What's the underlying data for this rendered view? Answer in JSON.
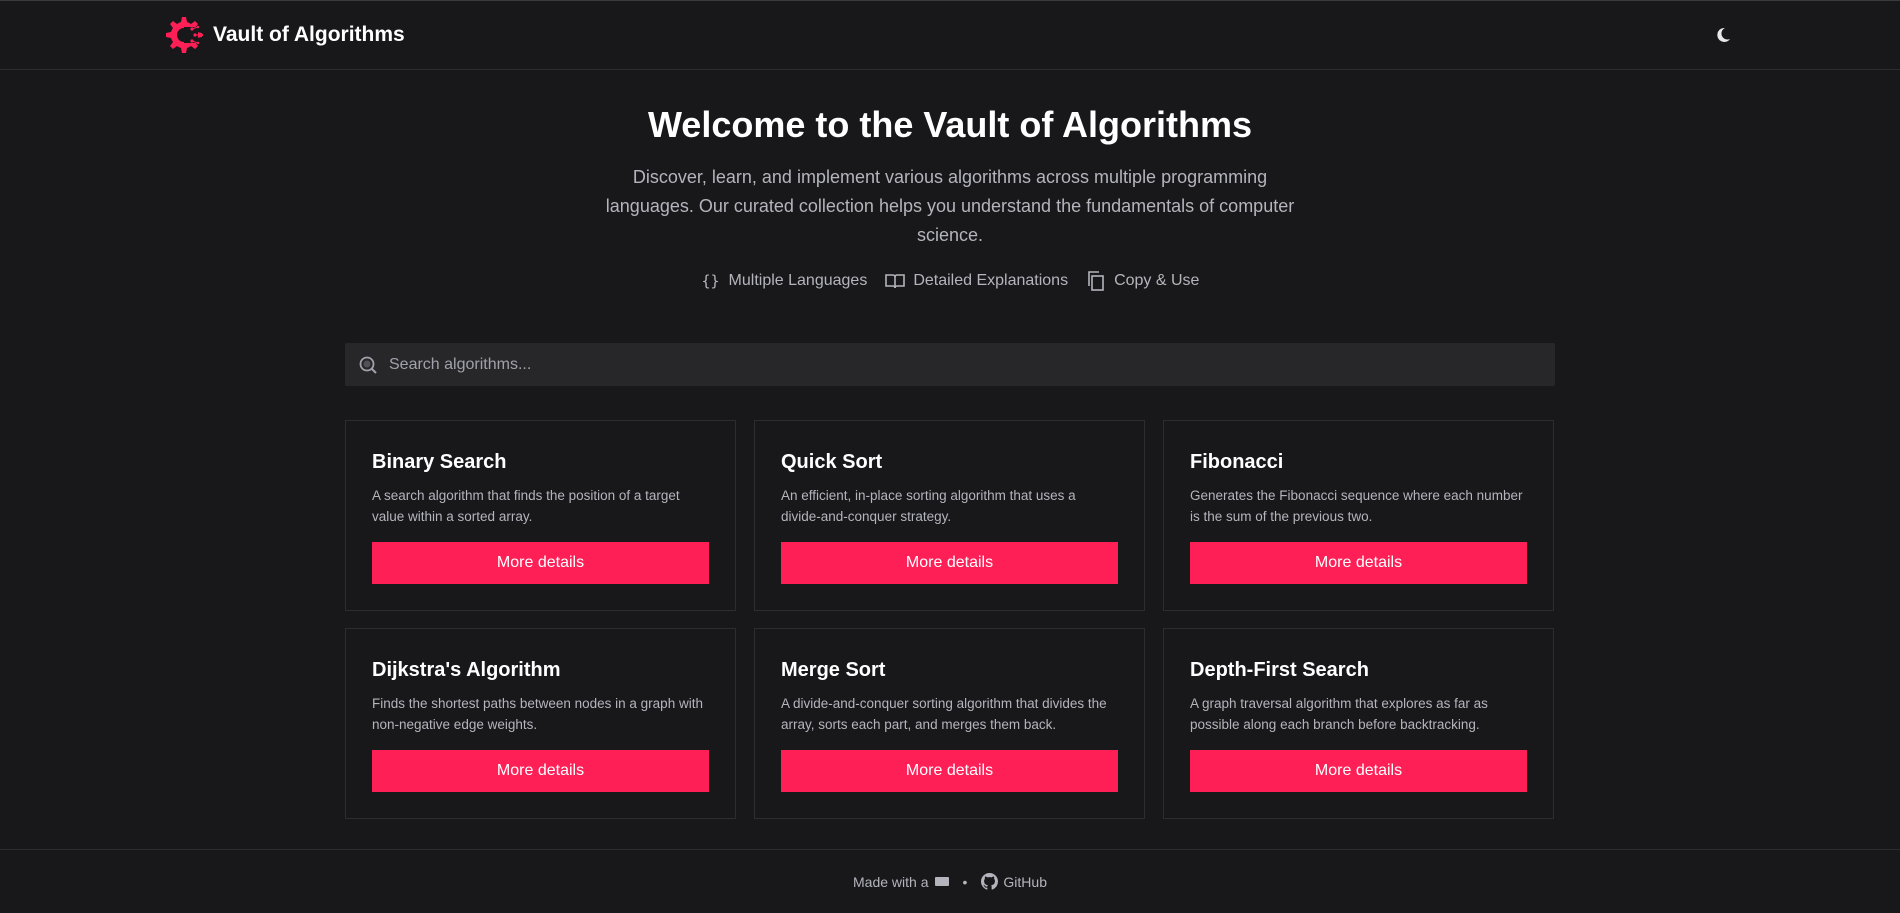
{
  "brand": {
    "name": "Vault of Algorithms",
    "logo_icon": "gear-logo-icon",
    "accent": "#ff1f57"
  },
  "header": {
    "theme_toggle_icon": "moon-icon"
  },
  "hero": {
    "title": "Welcome to the Vault of Algorithms",
    "subtitle": "Discover, learn, and implement various algorithms across multiple programming languages. Our curated collection helps you understand the fundamentals of computer science."
  },
  "features": [
    {
      "icon": "code-braces-icon",
      "label": "Multiple Languages"
    },
    {
      "icon": "book-icon",
      "label": "Detailed Explanations"
    },
    {
      "icon": "copy-icon",
      "label": "Copy & Use"
    }
  ],
  "search": {
    "placeholder": "Search algorithms...",
    "value": ""
  },
  "algorithms": [
    {
      "title": "Binary Search",
      "description": "A search algorithm that finds the position of a target value within a sorted array.",
      "button": "More details"
    },
    {
      "title": "Quick Sort",
      "description": "An efficient, in-place sorting algorithm that uses a divide-and-conquer strategy.",
      "button": "More details"
    },
    {
      "title": "Fibonacci",
      "description": "Generates the Fibonacci sequence where each number is the sum of the previous two.",
      "button": "More details"
    },
    {
      "title": "Dijkstra's Algorithm",
      "description": "Finds the shortest paths between nodes in a graph with non-negative edge weights.",
      "button": "More details"
    },
    {
      "title": "Merge Sort",
      "description": "A divide-and-conquer sorting algorithm that divides the array, sorts each part, and merges them back.",
      "button": "More details"
    },
    {
      "title": "Depth-First Search",
      "description": "A graph traversal algorithm that explores as far as possible along each branch before backtracking.",
      "button": "More details"
    }
  ],
  "footer": {
    "made_with": "Made with a",
    "separator": "•",
    "github": "GitHub"
  }
}
